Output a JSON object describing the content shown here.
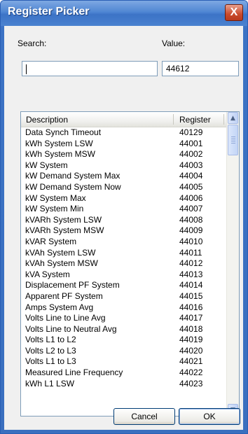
{
  "window": {
    "title": "Register Picker",
    "close_label": "X"
  },
  "search": {
    "label": "Search:",
    "value": ""
  },
  "value": {
    "label": "Value:",
    "value": "44612"
  },
  "table": {
    "columns": [
      "Description",
      "Register"
    ],
    "rows": [
      {
        "description": "Data Synch Timeout",
        "register": "40129"
      },
      {
        "description": "kWh System LSW",
        "register": "44001"
      },
      {
        "description": "kWh System MSW",
        "register": "44002"
      },
      {
        "description": "kW System",
        "register": "44003"
      },
      {
        "description": "kW Demand System Max",
        "register": "44004"
      },
      {
        "description": "kW Demand System Now",
        "register": "44005"
      },
      {
        "description": "kW System Max",
        "register": "44006"
      },
      {
        "description": "kW System Min",
        "register": "44007"
      },
      {
        "description": "kVARh System LSW",
        "register": "44008"
      },
      {
        "description": "kVARh System MSW",
        "register": "44009"
      },
      {
        "description": "kVAR System",
        "register": "44010"
      },
      {
        "description": "kVAh System LSW",
        "register": "44011"
      },
      {
        "description": "kVAh System MSW",
        "register": "44012"
      },
      {
        "description": "kVA System",
        "register": "44013"
      },
      {
        "description": "Displacement PF System",
        "register": "44014"
      },
      {
        "description": "Apparent PF System",
        "register": "44015"
      },
      {
        "description": "Amps System Avg",
        "register": "44016"
      },
      {
        "description": "Volts Line to Line Avg",
        "register": "44017"
      },
      {
        "description": "Volts Line to Neutral Avg",
        "register": "44018"
      },
      {
        "description": "Volts L1 to L2",
        "register": "44019"
      },
      {
        "description": "Volts L2 to L3",
        "register": "44020"
      },
      {
        "description": "Volts L1 to L3",
        "register": "44021"
      },
      {
        "description": "Measured Line Frequency",
        "register": "44022"
      },
      {
        "description": "kWh L1 LSW",
        "register": "44023"
      }
    ]
  },
  "buttons": {
    "cancel": "Cancel",
    "ok": "OK"
  },
  "icons": {
    "scroll_up": "scroll-up-arrow-icon",
    "scroll_down": "scroll-down-arrow-icon",
    "close": "close-icon"
  },
  "colors": {
    "titlebar": "#3c73c6",
    "close": "#c94a2c",
    "field_border": "#7f9db9"
  }
}
